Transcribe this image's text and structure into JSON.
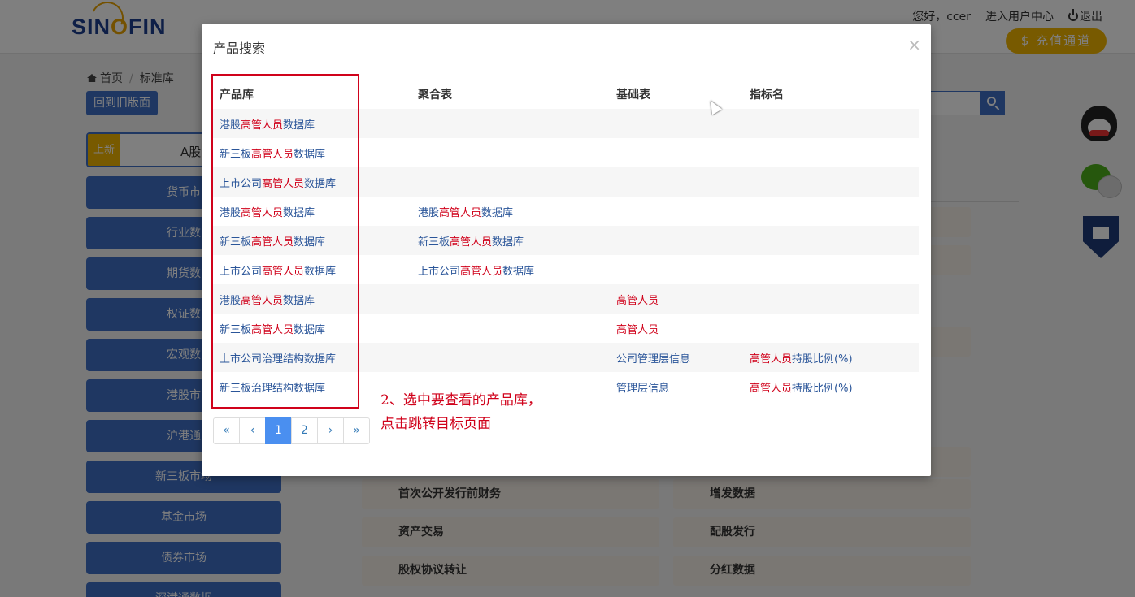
{
  "header": {
    "logo_text_before": "SIN",
    "logo_text_o": "O",
    "logo_text_after": "FIN",
    "greeting": "您好，ccer",
    "user_center": "进入用户中心",
    "logout": "退出",
    "recharge": "$ 充值通道"
  },
  "breadcrumb": {
    "home": "首页",
    "current": "标准库"
  },
  "old_version_button": "回到旧版面",
  "tabs": {
    "new_badge": "上新",
    "ashare": "A股"
  },
  "sidebar": {
    "items": [
      {
        "label": "货币市"
      },
      {
        "label": "行业数"
      },
      {
        "label": "期货数"
      },
      {
        "label": "权证数"
      },
      {
        "label": "宏观数"
      },
      {
        "label": "港股市"
      },
      {
        "label": "沪港通"
      },
      {
        "label": "新三板市场"
      },
      {
        "label": "基金市场"
      },
      {
        "label": "债券市场"
      },
      {
        "label": "深港通数据"
      }
    ]
  },
  "content_cards": [
    {
      "left": "首次公开发行前财务",
      "right": "增发数据"
    },
    {
      "left": "资产交易",
      "right": "配股发行"
    },
    {
      "left": "股权协议转让",
      "right": "分红数据"
    }
  ],
  "modal": {
    "title": "产品搜索",
    "close": "×",
    "columns": [
      "产品库",
      "聚合表",
      "基础表",
      "指标名"
    ],
    "rows": [
      {
        "c1": [
          "港股",
          "高管人员",
          "数据库"
        ],
        "c2": [
          "",
          "",
          ""
        ],
        "c3": [
          "",
          "",
          ""
        ],
        "c4": [
          "",
          "",
          ""
        ]
      },
      {
        "c1": [
          "新三板",
          "高管人员",
          "数据库"
        ],
        "c2": [
          "",
          "",
          ""
        ],
        "c3": [
          "",
          "",
          ""
        ],
        "c4": [
          "",
          "",
          ""
        ]
      },
      {
        "c1": [
          "上市公司",
          "高管人员",
          "数据库"
        ],
        "c2": [
          "",
          "",
          ""
        ],
        "c3": [
          "",
          "",
          ""
        ],
        "c4": [
          "",
          "",
          ""
        ]
      },
      {
        "c1": [
          "港股",
          "高管人员",
          "数据库"
        ],
        "c2": [
          "港股",
          "高管人员",
          "数据库"
        ],
        "c3": [
          "",
          "",
          ""
        ],
        "c4": [
          "",
          "",
          ""
        ]
      },
      {
        "c1": [
          "新三板",
          "高管人员",
          "数据库"
        ],
        "c2": [
          "新三板",
          "高管人员",
          "数据库"
        ],
        "c3": [
          "",
          "",
          ""
        ],
        "c4": [
          "",
          "",
          ""
        ]
      },
      {
        "c1": [
          "上市公司",
          "高管人员",
          "数据库"
        ],
        "c2": [
          "上市公司",
          "高管人员",
          "数据库"
        ],
        "c3": [
          "",
          "",
          ""
        ],
        "c4": [
          "",
          "",
          ""
        ]
      },
      {
        "c1": [
          "港股",
          "高管人员",
          "数据库"
        ],
        "c2": [
          "",
          "",
          ""
        ],
        "c3": [
          "",
          "高管人员",
          ""
        ],
        "c4": [
          "",
          "",
          ""
        ]
      },
      {
        "c1": [
          "新三板",
          "高管人员",
          "数据库"
        ],
        "c2": [
          "",
          "",
          ""
        ],
        "c3": [
          "",
          "高管人员",
          ""
        ],
        "c4": [
          "",
          "",
          ""
        ]
      },
      {
        "c1": [
          "上市公司治理结构数据库",
          "",
          ""
        ],
        "c2": [
          "",
          "",
          ""
        ],
        "c3": [
          "公司管理层信息",
          "",
          ""
        ],
        "c4": [
          "",
          "高管人员",
          "持股比例(%)"
        ]
      },
      {
        "c1": [
          "新三板治理结构数据库",
          "",
          ""
        ],
        "c2": [
          "",
          "",
          ""
        ],
        "c3": [
          "管理层信息",
          "",
          ""
        ],
        "c4": [
          "",
          "高管人员",
          "持股比例(%)"
        ]
      }
    ],
    "pagination": [
      "«",
      "‹",
      "1",
      "2",
      "›",
      "»"
    ],
    "active_page": "1"
  },
  "annotation": {
    "line1": "2、选中要查看的产品库，",
    "line2": "点击跳转目标页面"
  },
  "colors": {
    "primary_blue": "#3f6fc4",
    "highlight_red": "#d0021b",
    "link_blue": "#2a5599",
    "gold": "#f0b400"
  }
}
